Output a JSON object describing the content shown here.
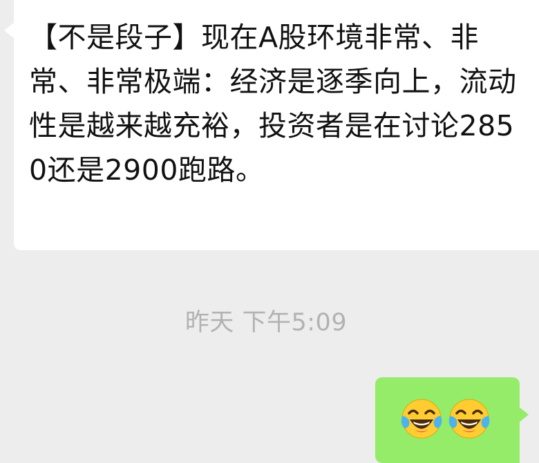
{
  "incoming_message": {
    "text": "【不是段子】现在A股环境非常、非常、非常极端：经济是逐季向上，流动性是越来越充裕，投资者是在讨论2850还是2900跑路。"
  },
  "timestamp": "昨天 下午5:09",
  "outgoing_message": {
    "emojis": [
      "face-with-tears-of-joy-icon",
      "face-with-tears-of-joy-icon"
    ]
  },
  "colors": {
    "background": "#ededed",
    "incoming_bubble": "#ffffff",
    "outgoing_bubble": "#95ec69",
    "timestamp_text": "#b2b2b2"
  }
}
